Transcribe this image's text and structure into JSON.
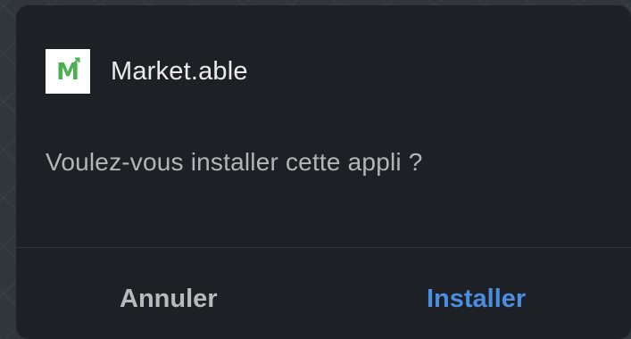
{
  "dialog": {
    "app_icon_letter": "M",
    "app_name": "Market.able",
    "message": "Voulez-vous installer cette appli ?",
    "cancel_label": "Annuler",
    "install_label": "Installer"
  },
  "colors": {
    "dialog_background": "#1d2024",
    "primary_action": "#4a8fe0",
    "icon_accent": "#4caf50"
  }
}
